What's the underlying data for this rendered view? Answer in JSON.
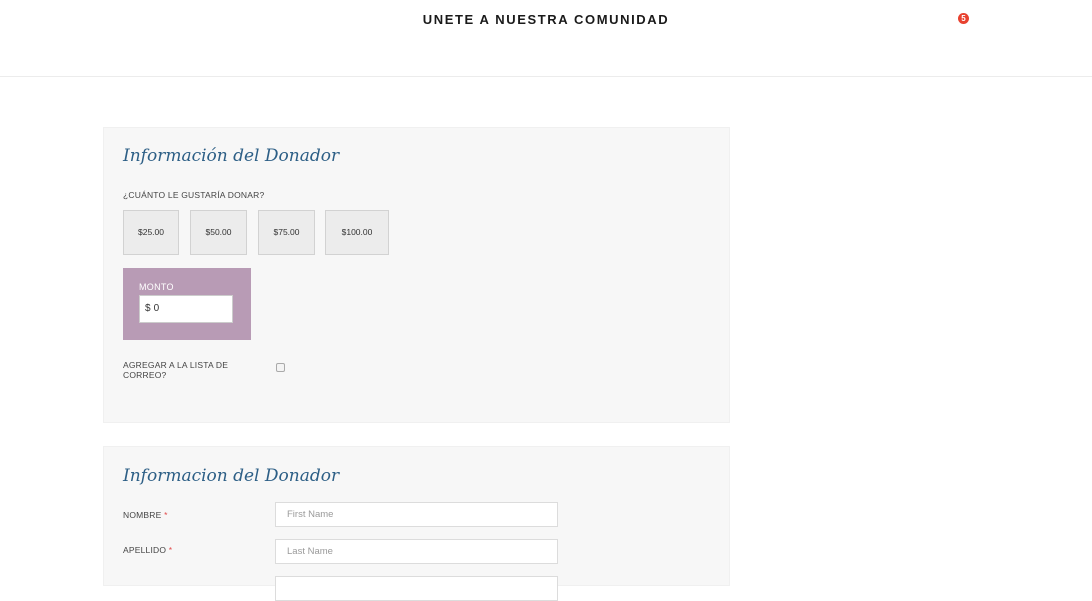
{
  "header": {
    "title": "UNETE A NUESTRA COMUNIDAD",
    "cart_count": "5"
  },
  "donation_panel": {
    "title": "Información del Donador",
    "question": "¿CUÁNTO LE GUSTARÍA DONAR?",
    "amounts": [
      "$25.00",
      "$50.00",
      "$75.00",
      "$100.00"
    ],
    "custom_amount": {
      "label": "MONTO",
      "currency": "$",
      "value": "0"
    },
    "newsletter_label": "AGREGAR A LA LISTA DE CORREO?",
    "newsletter_checked": false
  },
  "donor_panel": {
    "title": "Informacion del Donador",
    "fields": [
      {
        "label": "NOMBRE",
        "required_mark": "*",
        "placeholder": "First Name"
      },
      {
        "label": "APELLIDO",
        "required_mark": "*",
        "placeholder": "Last Name"
      }
    ]
  },
  "colors": {
    "accent_title": "#2d5f86",
    "monto_bg": "#b89bb5",
    "badge": "#e8412f"
  }
}
